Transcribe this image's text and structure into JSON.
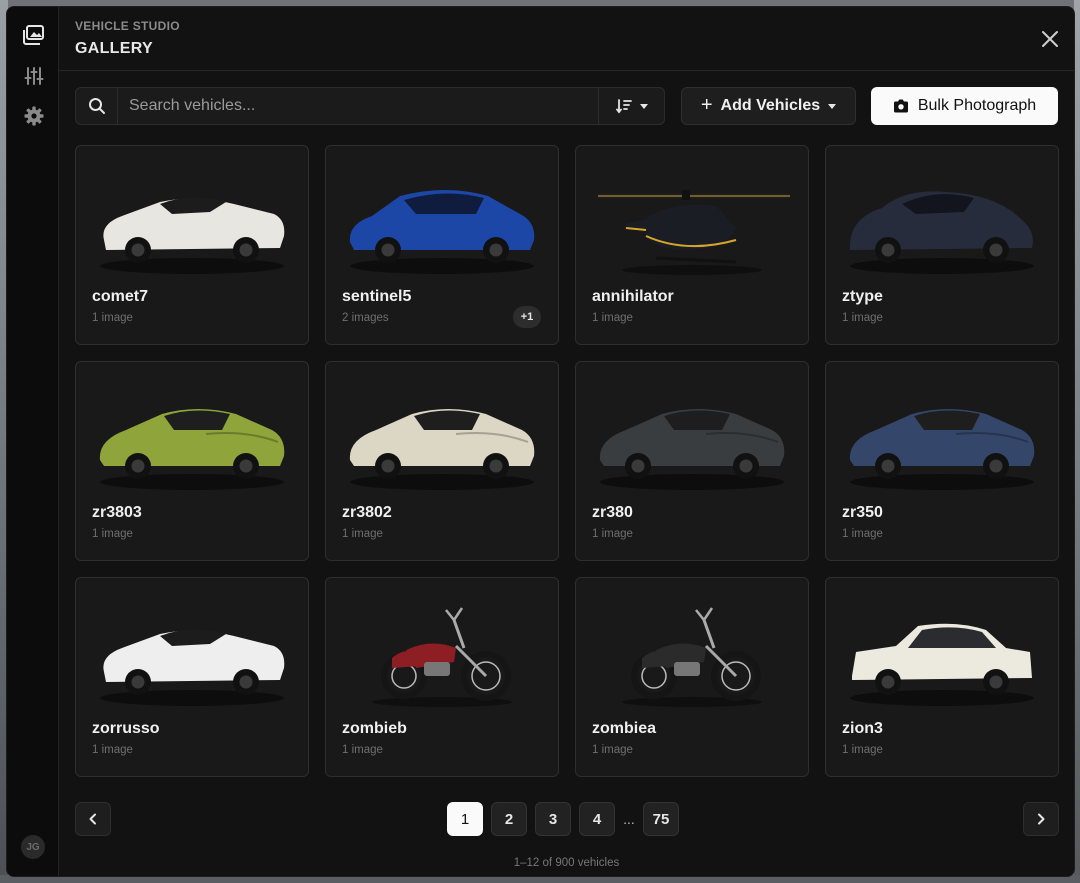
{
  "header": {
    "eyebrow": "VEHICLE STUDIO",
    "title": "GALLERY"
  },
  "rail": {
    "items": [
      {
        "icon": "gallery-icon",
        "active": true
      },
      {
        "icon": "sliders-icon",
        "active": false
      },
      {
        "icon": "gear-icon",
        "active": false
      }
    ],
    "avatar_initials": "JG"
  },
  "toolbar": {
    "search_placeholder": "Search vehicles...",
    "add_label": "Add Vehicles",
    "bulk_label": "Bulk Photograph"
  },
  "vehicles": [
    {
      "name": "comet7",
      "count": "1 image",
      "kind": "convertible",
      "color": "#e8e6e1"
    },
    {
      "name": "sentinel5",
      "count": "2 images",
      "kind": "sedan",
      "color": "#1d47a6",
      "extra": "+1"
    },
    {
      "name": "annihilator",
      "count": "1 image",
      "kind": "helicopter",
      "color": "#1b1d24"
    },
    {
      "name": "ztype",
      "count": "1 image",
      "kind": "classic",
      "color": "#272c3c"
    },
    {
      "name": "zr3803",
      "count": "1 image",
      "kind": "coupe",
      "color": "#8fa43a"
    },
    {
      "name": "zr3802",
      "count": "1 image",
      "kind": "coupe",
      "color": "#dcd7c4"
    },
    {
      "name": "zr380",
      "count": "1 image",
      "kind": "coupe",
      "color": "#3a3d40"
    },
    {
      "name": "zr350",
      "count": "1 image",
      "kind": "coupe",
      "color": "#34466a"
    },
    {
      "name": "zorrusso",
      "count": "1 image",
      "kind": "supercar",
      "color": "#eeeeee"
    },
    {
      "name": "zombieb",
      "count": "1 image",
      "kind": "chopper",
      "color": "#8c1e24"
    },
    {
      "name": "zombiea",
      "count": "1 image",
      "kind": "chopper",
      "color": "#2b2b2b"
    },
    {
      "name": "zion3",
      "count": "1 image",
      "kind": "sedan-classic",
      "color": "#ece9df"
    }
  ],
  "pagination": {
    "pages": [
      "1",
      "2",
      "3",
      "4"
    ],
    "ellipsis": "...",
    "last": "75",
    "current": "1",
    "summary": "1–12 of 900 vehicles"
  }
}
